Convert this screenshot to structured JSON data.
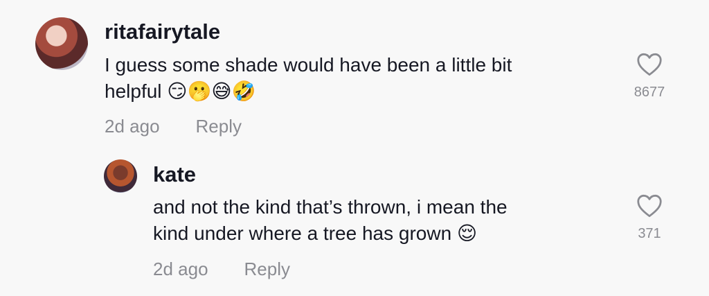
{
  "comments": [
    {
      "username": "ritafairytale",
      "text_line1": "I guess some shade would have been a little bit",
      "text_line2": "helpful 😏🫢😅🤣",
      "time": "2d ago",
      "reply_label": "Reply",
      "likes": "8677",
      "avatar_icon": "user-avatar"
    },
    {
      "username": "kate",
      "text_line1": "and not the kind that’s thrown, i mean the",
      "text_line2": "kind under where a tree has grown 😌",
      "time": "2d ago",
      "reply_label": "Reply",
      "likes": "371",
      "avatar_icon": "user-avatar"
    }
  ],
  "colors": {
    "background": "#f8f8f8",
    "text": "#161823",
    "meta": "#8a8b91"
  }
}
